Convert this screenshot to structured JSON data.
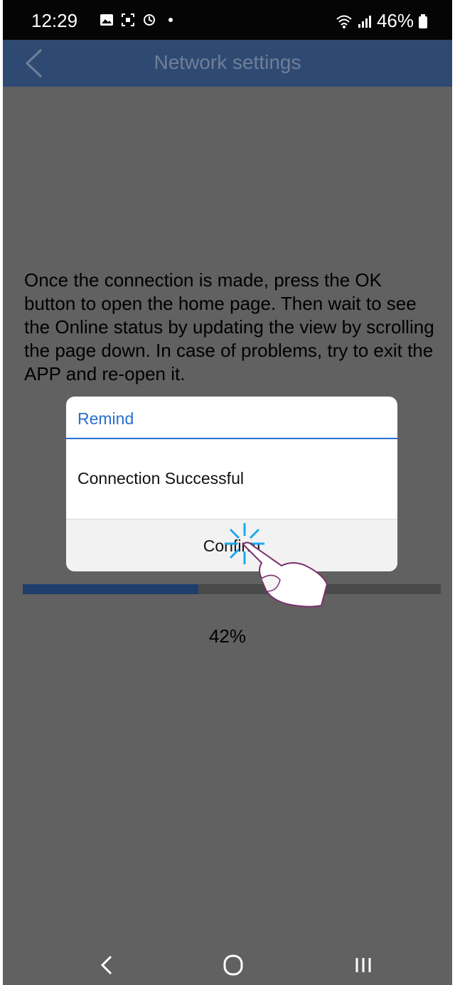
{
  "status_bar": {
    "time": "12:29",
    "battery": "46%",
    "icons": [
      "gallery-icon",
      "screenshot-icon",
      "sync-icon",
      "dot-icon",
      "wifi-icon",
      "signal-icon",
      "battery-icon"
    ]
  },
  "header": {
    "title": "Network settings",
    "back_icon": "chevron-left-icon"
  },
  "content": {
    "instructions": "Once the connection is made, press the OK button to open the home page. Then wait to see the Online status by updating the view by scrolling the page down. In case of problems, try to exit the APP and re-open it.",
    "progress_fraction": 0.42,
    "progress_label": "42%"
  },
  "dialog": {
    "title": "Remind",
    "message": "Connection Successful",
    "confirm_label": "Confirm"
  },
  "nav_bar": {
    "items": [
      "back-icon",
      "home-icon",
      "recents-icon"
    ]
  },
  "colors": {
    "header_bg": "#2f4a72",
    "dialog_accent": "#2a6fcf",
    "progress_fill": "#1f3e6c",
    "overlay_bg": "#616161",
    "tap_highlight": "#19a9f0"
  }
}
